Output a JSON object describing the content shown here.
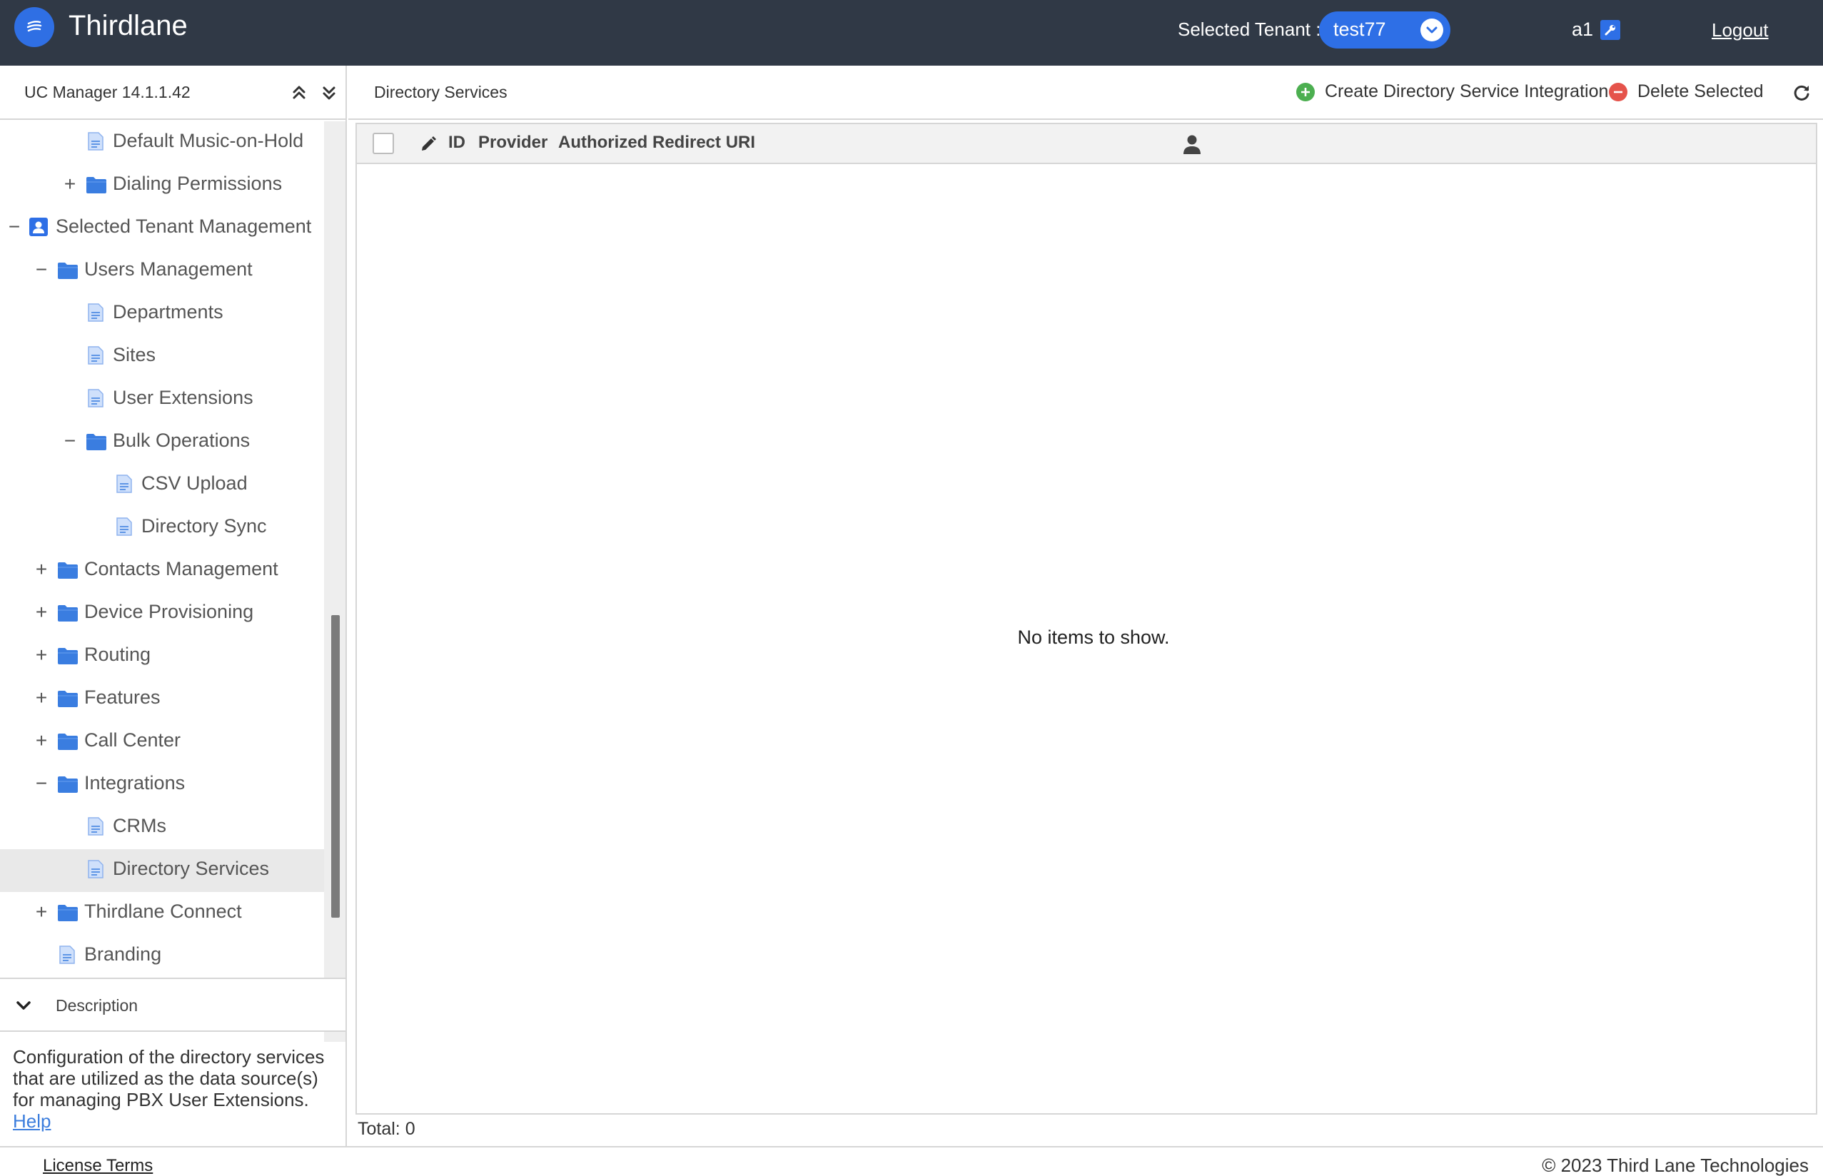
{
  "header": {
    "app_title": "Thirdlane",
    "tenant_label": "Selected Tenant :",
    "tenant_value": "test77",
    "user_name": "a1",
    "logout_label": "Logout"
  },
  "sidebar": {
    "version": "UC Manager 14.1.1.42",
    "tree": [
      {
        "label": "Default Music-on-Hold",
        "type": "page",
        "level": 3,
        "toggle": ""
      },
      {
        "label": "Dialing Permissions",
        "type": "folder",
        "level": 3,
        "toggle": "+"
      },
      {
        "label": "Selected Tenant Management",
        "type": "tenant",
        "level": 1,
        "toggle": "−"
      },
      {
        "label": "Users Management",
        "type": "folder",
        "level": 2,
        "toggle": "−"
      },
      {
        "label": "Departments",
        "type": "page",
        "level": 3,
        "toggle": ""
      },
      {
        "label": "Sites",
        "type": "page",
        "level": 3,
        "toggle": ""
      },
      {
        "label": "User Extensions",
        "type": "page",
        "level": 3,
        "toggle": ""
      },
      {
        "label": "Bulk Operations",
        "type": "folder",
        "level": 3,
        "toggle": "−"
      },
      {
        "label": "CSV Upload",
        "type": "page",
        "level": 4,
        "toggle": ""
      },
      {
        "label": "Directory Sync",
        "type": "page",
        "level": 4,
        "toggle": ""
      },
      {
        "label": "Contacts Management",
        "type": "folder",
        "level": 2,
        "toggle": "+"
      },
      {
        "label": "Device Provisioning",
        "type": "folder",
        "level": 2,
        "toggle": "+"
      },
      {
        "label": "Routing",
        "type": "folder",
        "level": 2,
        "toggle": "+"
      },
      {
        "label": "Features",
        "type": "folder",
        "level": 2,
        "toggle": "+"
      },
      {
        "label": "Call Center",
        "type": "folder",
        "level": 2,
        "toggle": "+"
      },
      {
        "label": "Integrations",
        "type": "folder",
        "level": 2,
        "toggle": "−"
      },
      {
        "label": "CRMs",
        "type": "page",
        "level": 3,
        "toggle": ""
      },
      {
        "label": "Directory Services",
        "type": "page",
        "level": 3,
        "toggle": "",
        "selected": true
      },
      {
        "label": "Thirdlane Connect",
        "type": "folder",
        "level": 2,
        "toggle": "+"
      },
      {
        "label": "Branding",
        "type": "page",
        "level": 2,
        "toggle": ""
      }
    ],
    "description": {
      "title": "Description",
      "text": "Configuration of the directory services that are utilized as the data source(s) for managing PBX User Extensions.",
      "help_label": "Help"
    }
  },
  "main": {
    "title": "Directory Services",
    "create_label": "Create Directory Service Integration",
    "delete_label": "Delete Selected",
    "columns": {
      "id": "ID",
      "provider": "Provider",
      "redirect_uri": "Authorized Redirect URI"
    },
    "empty_message": "No items to show.",
    "total": "Total: 0"
  },
  "footer": {
    "license": "License Terms",
    "copyright": "© 2023 Third Lane Technologies"
  },
  "colors": {
    "header_bg": "#303946",
    "accent": "#2e6fe6",
    "add_green": "#4caf50",
    "delete_red": "#e5534b",
    "folder_blue": "#3a7de0",
    "selected_row": "#e9e9e9"
  }
}
